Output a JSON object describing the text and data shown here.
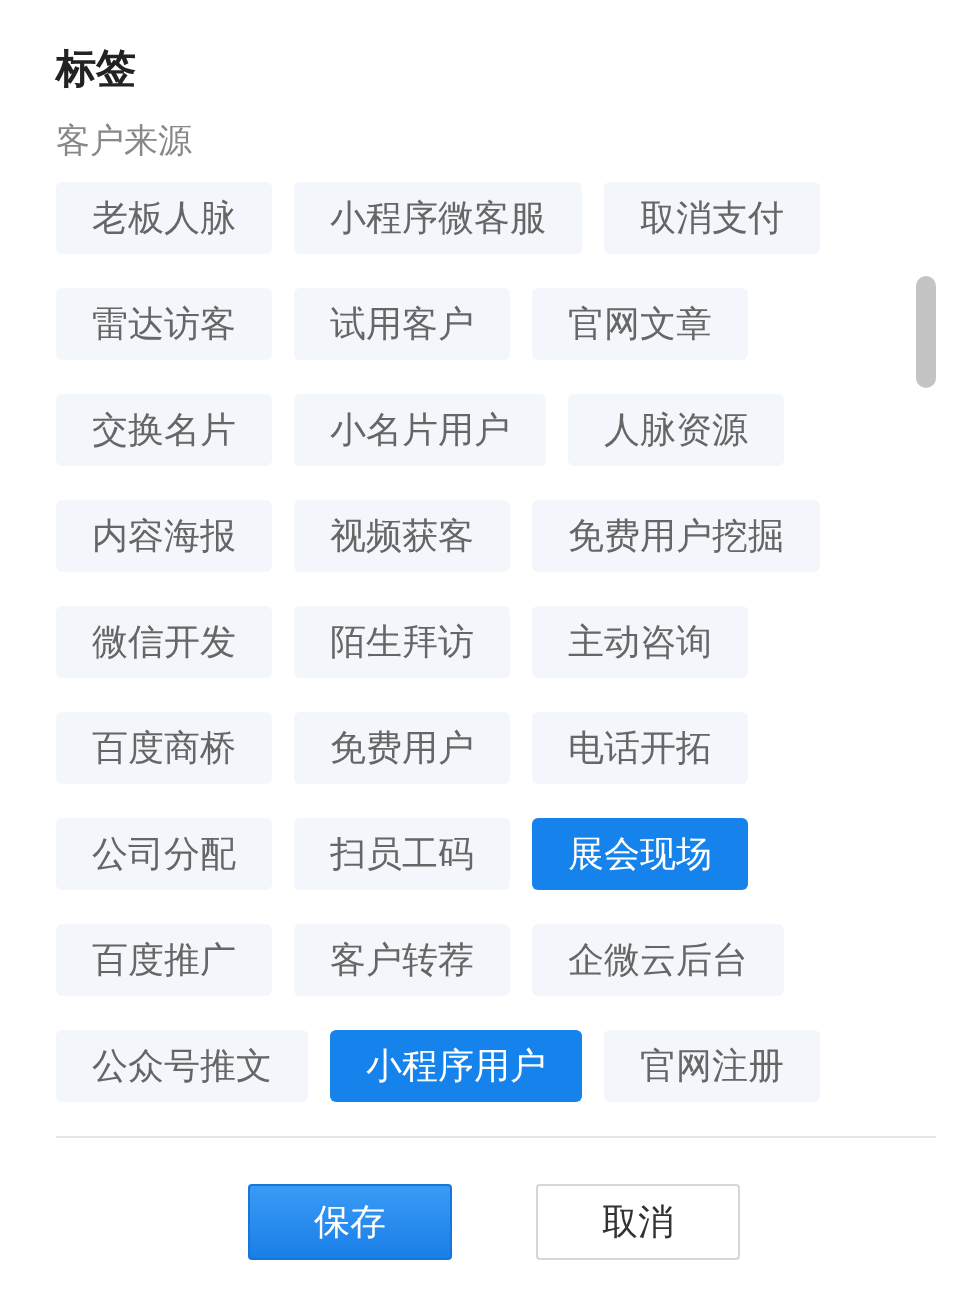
{
  "title": "标签",
  "group": {
    "label": "客户来源",
    "tags": [
      {
        "label": "老板人脉",
        "selected": false
      },
      {
        "label": "小程序微客服",
        "selected": false
      },
      {
        "label": "取消支付",
        "selected": false
      },
      {
        "label": "雷达访客",
        "selected": false
      },
      {
        "label": "试用客户",
        "selected": false
      },
      {
        "label": "官网文章",
        "selected": false
      },
      {
        "label": "交换名片",
        "selected": false
      },
      {
        "label": "小名片用户",
        "selected": false
      },
      {
        "label": "人脉资源",
        "selected": false
      },
      {
        "label": "内容海报",
        "selected": false
      },
      {
        "label": "视频获客",
        "selected": false
      },
      {
        "label": "免费用户挖掘",
        "selected": false
      },
      {
        "label": "微信开发",
        "selected": false
      },
      {
        "label": "陌生拜访",
        "selected": false
      },
      {
        "label": "主动咨询",
        "selected": false
      },
      {
        "label": "百度商桥",
        "selected": false
      },
      {
        "label": "免费用户",
        "selected": false
      },
      {
        "label": "电话开拓",
        "selected": false
      },
      {
        "label": "公司分配",
        "selected": false
      },
      {
        "label": "扫员工码",
        "selected": false
      },
      {
        "label": "展会现场",
        "selected": true
      },
      {
        "label": "百度推广",
        "selected": false
      },
      {
        "label": "客户转荐",
        "selected": false
      },
      {
        "label": "企微云后台",
        "selected": false
      },
      {
        "label": "公众号推文",
        "selected": false
      },
      {
        "label": "小程序用户",
        "selected": true
      },
      {
        "label": "官网注册",
        "selected": false
      }
    ]
  },
  "buttons": [
    {
      "label": "保存",
      "kind": "primary"
    },
    {
      "label": "取消",
      "kind": "secondary"
    }
  ]
}
